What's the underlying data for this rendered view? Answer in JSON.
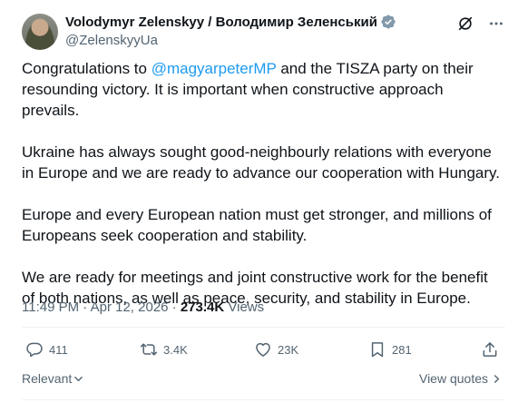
{
  "author": {
    "display_name": "Volodymyr Zelenskyy / Володимир Зеленський",
    "handle": "@ZelenskyyUa"
  },
  "post": {
    "para1_prefix": "Congratulations to ",
    "para1_mention": "@magyarpeterMP",
    "para1_suffix": " and the TISZA party on their resounding victory. It is important when  constructive approach prevails.",
    "para2": "Ukraine has always sought good-neighbourly relations with everyone in Europe and we are ready to advance our cooperation with Hungary.",
    "para3": "Europe and every European nation must get stronger, and millions of Europeans seek cooperation and stability.",
    "para4": "We are ready for meetings and joint constructive work for the benefit of both nations, as well as peace, security, and stability in Europe."
  },
  "meta": {
    "time": "11:49 PM",
    "separator": " · ",
    "date": "Apr 12, 2026",
    "separator2": " · ",
    "views_count": "273.4K",
    "views_label": " Views"
  },
  "actions": {
    "replies": "411",
    "reposts": "3.4K",
    "likes": "23K",
    "bookmarks": "281"
  },
  "footer": {
    "sort_label": "Relevant",
    "view_quotes": "View quotes"
  },
  "colors": {
    "accent": "#1d9bf0",
    "muted": "#536471",
    "text": "#0f1419"
  }
}
